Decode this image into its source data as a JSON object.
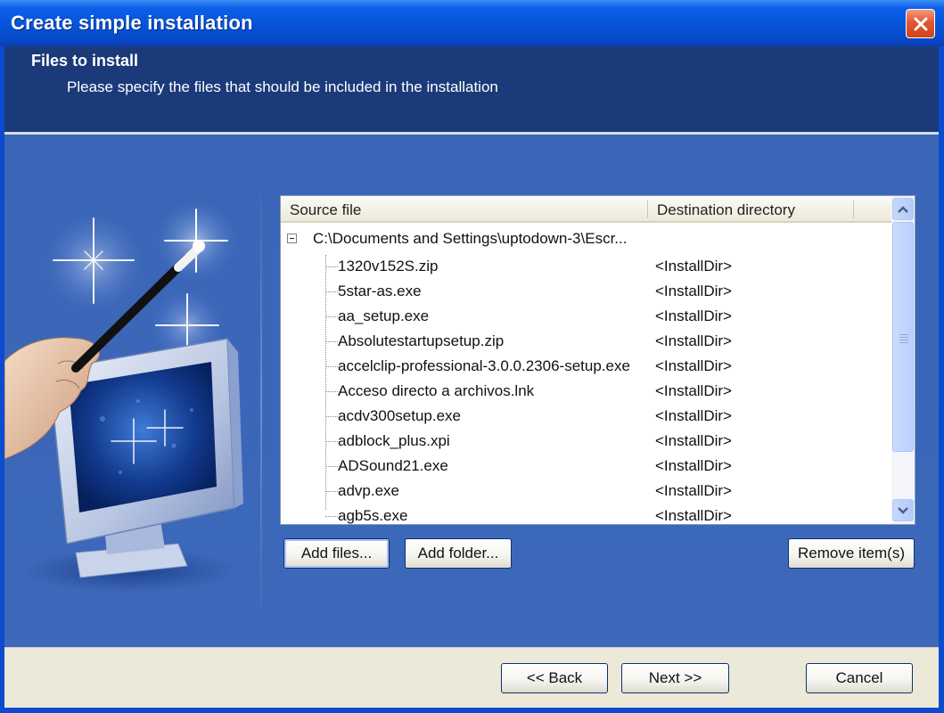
{
  "window": {
    "title": "Create simple installation"
  },
  "header": {
    "title": "Files to install",
    "subtitle": "Please specify the files that should be included in the installation"
  },
  "list": {
    "columns": [
      "Source file",
      "Destination directory"
    ],
    "root": "C:\\Documents and Settings\\uptodown-3\\Escr...",
    "rows": [
      {
        "source": "1320v152S.zip",
        "destination": "<InstallDir>"
      },
      {
        "source": "5star-as.exe",
        "destination": "<InstallDir>"
      },
      {
        "source": "aa_setup.exe",
        "destination": "<InstallDir>"
      },
      {
        "source": "Absolutestartupsetup.zip",
        "destination": "<InstallDir>"
      },
      {
        "source": "accelclip-professional-3.0.0.2306-setup.exe",
        "destination": "<InstallDir>"
      },
      {
        "source": "Acceso directo a archivos.lnk",
        "destination": "<InstallDir>"
      },
      {
        "source": "acdv300setup.exe",
        "destination": "<InstallDir>"
      },
      {
        "source": "adblock_plus.xpi",
        "destination": "<InstallDir>"
      },
      {
        "source": "ADSound21.exe",
        "destination": "<InstallDir>"
      },
      {
        "source": "advp.exe",
        "destination": "<InstallDir>"
      },
      {
        "source": "agb5s.exe",
        "destination": "<InstallDir>"
      }
    ]
  },
  "buttons": {
    "add_files": "Add files...",
    "add_folder": "Add folder...",
    "remove_items": "Remove item(s)",
    "back": "<< Back",
    "next": "Next >>",
    "cancel": "Cancel"
  },
  "icons": {
    "close": "close-icon",
    "wizard": "magic-wand-monitor-illustration",
    "scroll_up": "chevron-up-icon",
    "scroll_down": "chevron-down-icon"
  },
  "colors": {
    "titlebar": "#0653d8",
    "header": "#1a3a7a",
    "content": "#3b66b7",
    "close_button": "#d1421c",
    "footer": "#ece9d8"
  }
}
